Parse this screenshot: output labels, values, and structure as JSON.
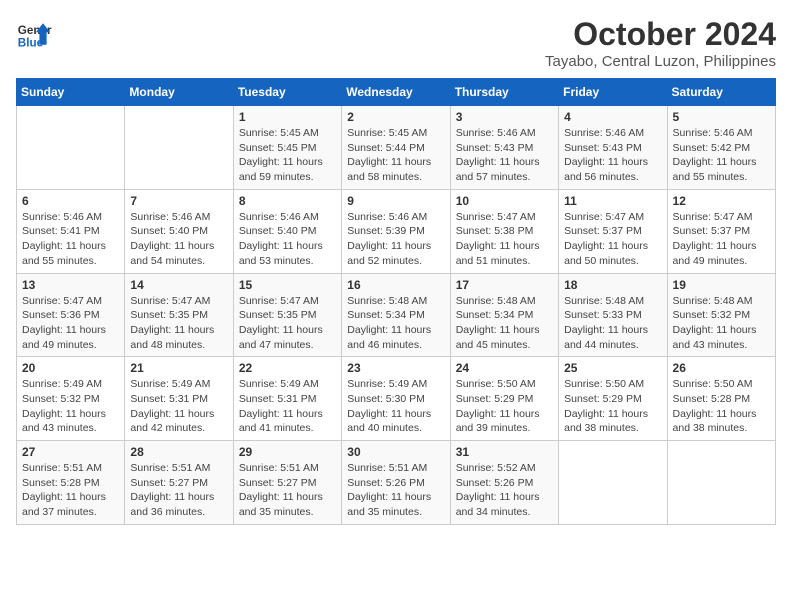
{
  "header": {
    "logo_line1": "General",
    "logo_line2": "Blue",
    "month": "October 2024",
    "location": "Tayabo, Central Luzon, Philippines"
  },
  "days_of_week": [
    "Sunday",
    "Monday",
    "Tuesday",
    "Wednesday",
    "Thursday",
    "Friday",
    "Saturday"
  ],
  "weeks": [
    [
      {
        "day": "",
        "data": ""
      },
      {
        "day": "",
        "data": ""
      },
      {
        "day": "1",
        "data": "Sunrise: 5:45 AM\nSunset: 5:45 PM\nDaylight: 11 hours and 59 minutes."
      },
      {
        "day": "2",
        "data": "Sunrise: 5:45 AM\nSunset: 5:44 PM\nDaylight: 11 hours and 58 minutes."
      },
      {
        "day": "3",
        "data": "Sunrise: 5:46 AM\nSunset: 5:43 PM\nDaylight: 11 hours and 57 minutes."
      },
      {
        "day": "4",
        "data": "Sunrise: 5:46 AM\nSunset: 5:43 PM\nDaylight: 11 hours and 56 minutes."
      },
      {
        "day": "5",
        "data": "Sunrise: 5:46 AM\nSunset: 5:42 PM\nDaylight: 11 hours and 55 minutes."
      }
    ],
    [
      {
        "day": "6",
        "data": "Sunrise: 5:46 AM\nSunset: 5:41 PM\nDaylight: 11 hours and 55 minutes."
      },
      {
        "day": "7",
        "data": "Sunrise: 5:46 AM\nSunset: 5:40 PM\nDaylight: 11 hours and 54 minutes."
      },
      {
        "day": "8",
        "data": "Sunrise: 5:46 AM\nSunset: 5:40 PM\nDaylight: 11 hours and 53 minutes."
      },
      {
        "day": "9",
        "data": "Sunrise: 5:46 AM\nSunset: 5:39 PM\nDaylight: 11 hours and 52 minutes."
      },
      {
        "day": "10",
        "data": "Sunrise: 5:47 AM\nSunset: 5:38 PM\nDaylight: 11 hours and 51 minutes."
      },
      {
        "day": "11",
        "data": "Sunrise: 5:47 AM\nSunset: 5:37 PM\nDaylight: 11 hours and 50 minutes."
      },
      {
        "day": "12",
        "data": "Sunrise: 5:47 AM\nSunset: 5:37 PM\nDaylight: 11 hours and 49 minutes."
      }
    ],
    [
      {
        "day": "13",
        "data": "Sunrise: 5:47 AM\nSunset: 5:36 PM\nDaylight: 11 hours and 49 minutes."
      },
      {
        "day": "14",
        "data": "Sunrise: 5:47 AM\nSunset: 5:35 PM\nDaylight: 11 hours and 48 minutes."
      },
      {
        "day": "15",
        "data": "Sunrise: 5:47 AM\nSunset: 5:35 PM\nDaylight: 11 hours and 47 minutes."
      },
      {
        "day": "16",
        "data": "Sunrise: 5:48 AM\nSunset: 5:34 PM\nDaylight: 11 hours and 46 minutes."
      },
      {
        "day": "17",
        "data": "Sunrise: 5:48 AM\nSunset: 5:34 PM\nDaylight: 11 hours and 45 minutes."
      },
      {
        "day": "18",
        "data": "Sunrise: 5:48 AM\nSunset: 5:33 PM\nDaylight: 11 hours and 44 minutes."
      },
      {
        "day": "19",
        "data": "Sunrise: 5:48 AM\nSunset: 5:32 PM\nDaylight: 11 hours and 43 minutes."
      }
    ],
    [
      {
        "day": "20",
        "data": "Sunrise: 5:49 AM\nSunset: 5:32 PM\nDaylight: 11 hours and 43 minutes."
      },
      {
        "day": "21",
        "data": "Sunrise: 5:49 AM\nSunset: 5:31 PM\nDaylight: 11 hours and 42 minutes."
      },
      {
        "day": "22",
        "data": "Sunrise: 5:49 AM\nSunset: 5:31 PM\nDaylight: 11 hours and 41 minutes."
      },
      {
        "day": "23",
        "data": "Sunrise: 5:49 AM\nSunset: 5:30 PM\nDaylight: 11 hours and 40 minutes."
      },
      {
        "day": "24",
        "data": "Sunrise: 5:50 AM\nSunset: 5:29 PM\nDaylight: 11 hours and 39 minutes."
      },
      {
        "day": "25",
        "data": "Sunrise: 5:50 AM\nSunset: 5:29 PM\nDaylight: 11 hours and 38 minutes."
      },
      {
        "day": "26",
        "data": "Sunrise: 5:50 AM\nSunset: 5:28 PM\nDaylight: 11 hours and 38 minutes."
      }
    ],
    [
      {
        "day": "27",
        "data": "Sunrise: 5:51 AM\nSunset: 5:28 PM\nDaylight: 11 hours and 37 minutes."
      },
      {
        "day": "28",
        "data": "Sunrise: 5:51 AM\nSunset: 5:27 PM\nDaylight: 11 hours and 36 minutes."
      },
      {
        "day": "29",
        "data": "Sunrise: 5:51 AM\nSunset: 5:27 PM\nDaylight: 11 hours and 35 minutes."
      },
      {
        "day": "30",
        "data": "Sunrise: 5:51 AM\nSunset: 5:26 PM\nDaylight: 11 hours and 35 minutes."
      },
      {
        "day": "31",
        "data": "Sunrise: 5:52 AM\nSunset: 5:26 PM\nDaylight: 11 hours and 34 minutes."
      },
      {
        "day": "",
        "data": ""
      },
      {
        "day": "",
        "data": ""
      }
    ]
  ]
}
